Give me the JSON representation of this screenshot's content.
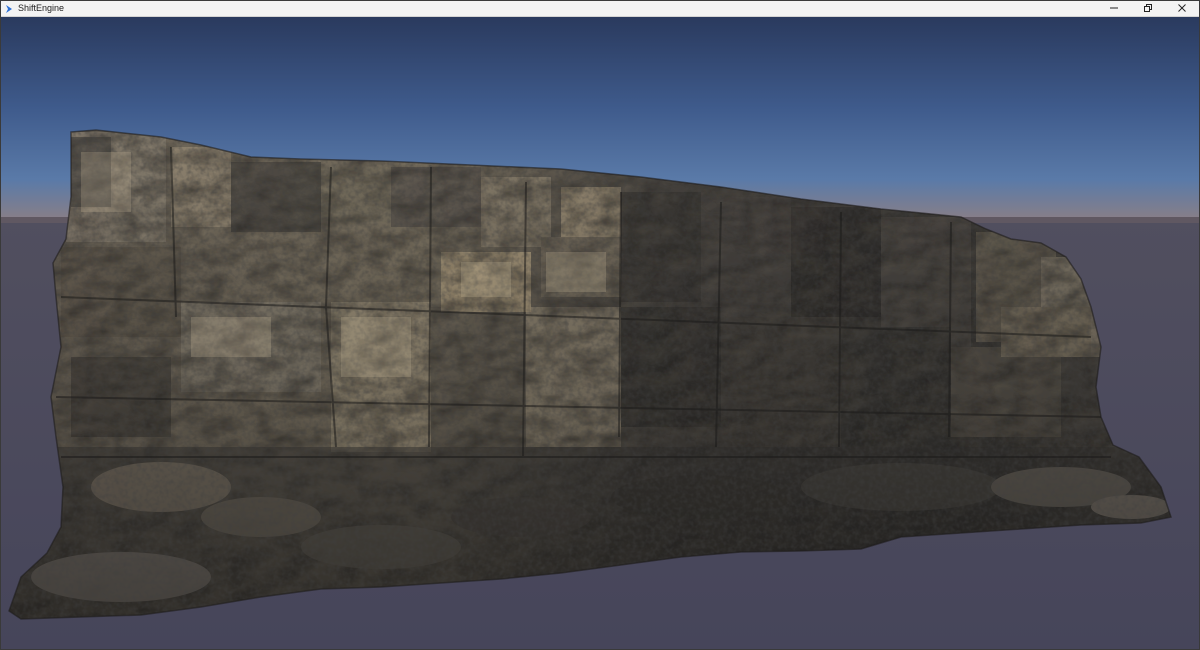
{
  "window": {
    "title": "ShiftEngine",
    "controls": {
      "minimize_icon": "minimize-icon",
      "restore_icon": "restore-icon",
      "close_icon": "close-icon"
    }
  },
  "viewport": {
    "scene": "photoscanned-rock-cliff",
    "colors": {
      "sky_top": "#2a3a5e",
      "sky_mid": "#4a6a9c",
      "horizon_glow": "#b8876a",
      "ground": "#4c4c5e",
      "rock_light": "#8a7f6c",
      "rock_dark": "#2e2c2b"
    }
  }
}
